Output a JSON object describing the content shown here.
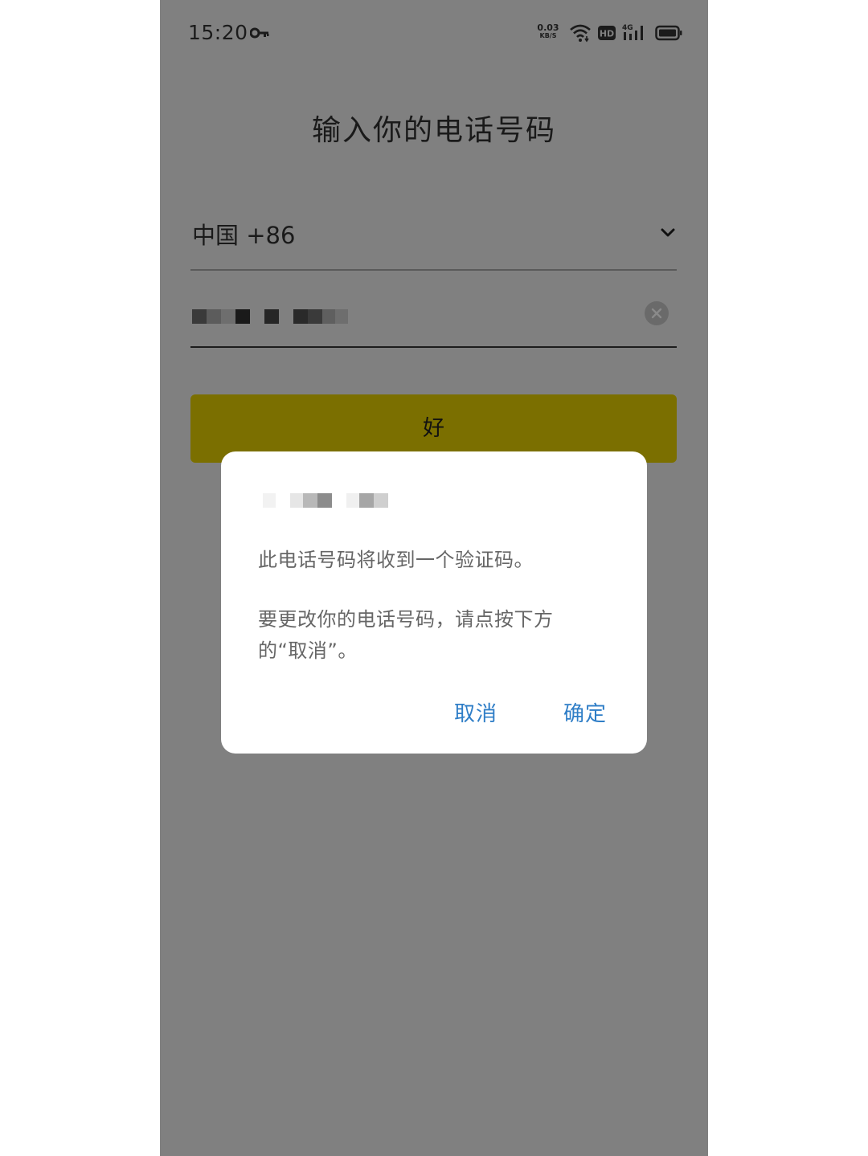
{
  "status_bar": {
    "time": "15:20",
    "net_speed_value": "0.03",
    "net_speed_unit": "KB/S",
    "hd_label": "HD",
    "network_label": "4G",
    "icons": [
      "key-icon",
      "wifi-icon",
      "hd-icon",
      "signal-icon",
      "battery-icon"
    ]
  },
  "screen": {
    "title": "输入你的电话号码",
    "country_selector": "中国 +86",
    "confirm_button": "好"
  },
  "dialog": {
    "message_line1": "此电话号码将收到一个验证码。",
    "message_line2": "要更改你的电话号码，请点按下方的“取消”。",
    "cancel_label": "取消",
    "confirm_label": "确定"
  },
  "colors": {
    "overlay_bg": "#808080",
    "button_bg": "#7b6f00",
    "dialog_action": "#2f7ec7"
  }
}
